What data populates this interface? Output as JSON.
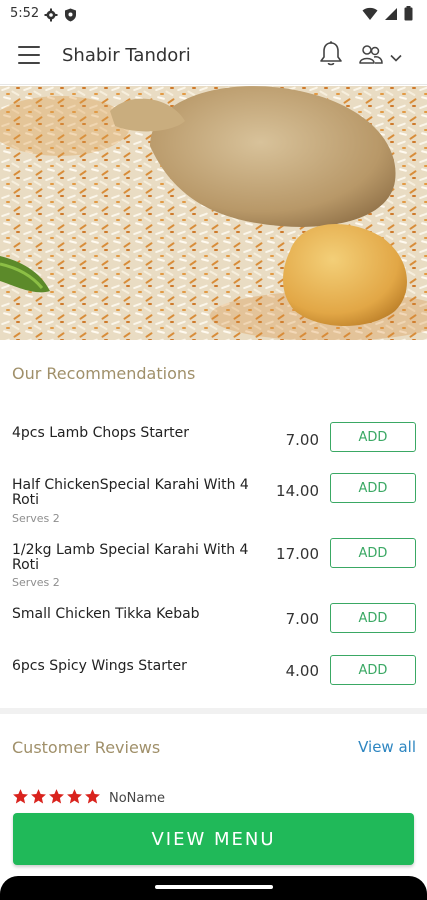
{
  "status_bar": {
    "time": "5:52",
    "icons": [
      "gear-icon",
      "shield-icon",
      "wifi-icon",
      "signal-icon",
      "battery-icon"
    ]
  },
  "app_bar": {
    "title": "Shabir Tandori",
    "icons": [
      "hamburger-menu-icon",
      "bell-icon",
      "user-group-icon",
      "chevron-down-icon"
    ]
  },
  "hero": {
    "image": "biryani-chicken-photo"
  },
  "recommendations": {
    "title": "Our Recommendations",
    "items": [
      {
        "name": "4pcs Lamb Chops Starter",
        "serves": "",
        "price": "7.00",
        "button": "ADD"
      },
      {
        "name": "Half ChickenSpecial Karahi With 4 Roti",
        "serves": "Serves 2",
        "price": "14.00",
        "button": "ADD"
      },
      {
        "name": "1/2kg Lamb Special Karahi With 4 Roti",
        "serves": "Serves 2",
        "price": "17.00",
        "button": "ADD"
      },
      {
        "name": "Small Chicken Tikka Kebab",
        "serves": "",
        "price": "7.00",
        "button": "ADD"
      },
      {
        "name": "6pcs Spicy Wings Starter",
        "serves": "",
        "price": "4.00",
        "button": "ADD"
      }
    ]
  },
  "reviews": {
    "title": "Customer Reviews",
    "view_all": "View all",
    "first_review": {
      "rating": 5,
      "reviewer": "NoName"
    }
  },
  "footer": {
    "button": "VIEW MENU"
  },
  "colors": {
    "accent_green": "#20b959",
    "add_green": "#3aa864",
    "section_gold": "#a0906a",
    "link_blue": "#2e86c1",
    "star_red": "#d9231d"
  }
}
